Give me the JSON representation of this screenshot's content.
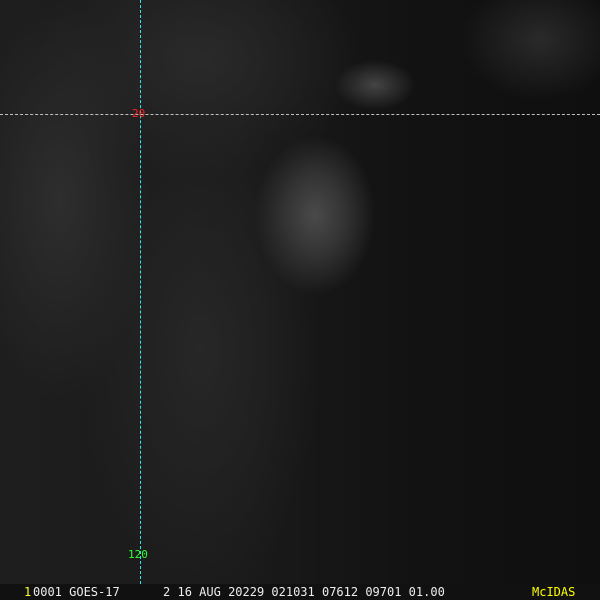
{
  "grid": {
    "lat_label": "20",
    "lon_label": "120"
  },
  "footer": {
    "frame": "1",
    "info": "0001 GOES-17      2 16 AUG 20229 021031 07612 09701 01.00",
    "brand": "McIDAS"
  },
  "colors": {
    "lat_line": "#bfbfbf",
    "lon_line": "#2ee6f0",
    "lat_label": "#ff2020",
    "lon_label": "#30ff30",
    "brand": "#ffff00"
  }
}
